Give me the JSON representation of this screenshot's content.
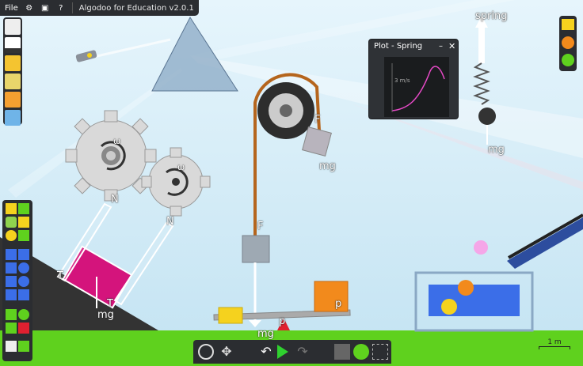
{
  "app": {
    "title": "Algodoo for Education v2.0.1"
  },
  "menu": {
    "file": "File"
  },
  "plot": {
    "title": "Plot - Spring",
    "axis_label": "3 m/s"
  },
  "labels": {
    "spring": "spring",
    "mg_spring": "mg",
    "F_pulley": "F",
    "mg_box": "mg",
    "F_rope": "F",
    "mg_seesaw": "mg",
    "p_seesaw": "p",
    "p_box": "p",
    "N_left": "N",
    "N_right": "N",
    "T_top": "T",
    "T_bottom": "T",
    "mg_ramp": "mg",
    "omega_big": "ω",
    "omega_small": "ω"
  },
  "scale": {
    "label": "1 m"
  },
  "colors": {
    "sky": "#d4ecf7",
    "ground": "#5fd11e",
    "ramp": "#333333",
    "magenta_box": "#d4147c",
    "orange_box": "#f28a1c",
    "yellow_box": "#f5d21e",
    "toolbar": "#2b2d31",
    "water": "#3b6ee8"
  },
  "icons": {
    "new_scene": "document-icon",
    "settings": "gear-icon",
    "browser": "window-icon",
    "help": "question-icon",
    "zoom": "zoom-icon",
    "pan": "move-icon",
    "undo": "undo-icon",
    "play": "play-icon",
    "redo": "redo-icon",
    "gravity": "gravity-icon",
    "air": "air-icon",
    "grid": "grid-icon"
  }
}
